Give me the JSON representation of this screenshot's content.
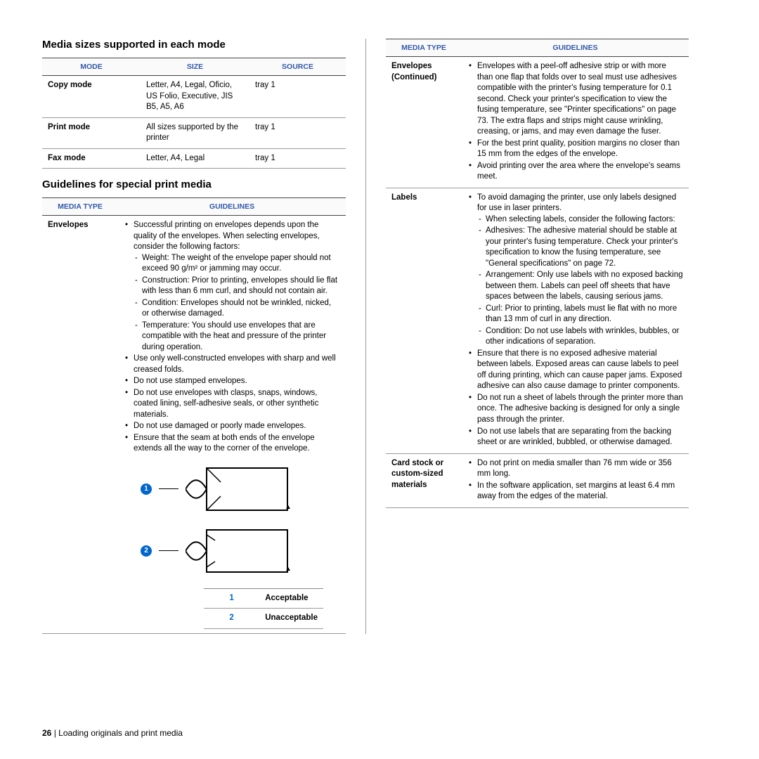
{
  "headings": {
    "media_sizes": "Media sizes supported in each mode",
    "guidelines_special": "Guidelines for special print media"
  },
  "modes_table": {
    "headers": [
      "Mode",
      "Size",
      "Source"
    ],
    "rows": [
      {
        "mode": "Copy mode",
        "size": "Letter, A4, Legal, Oficio, US Folio, Executive, JIS B5, A5, A6",
        "source": "tray 1"
      },
      {
        "mode": "Print mode",
        "size": "All sizes supported by the printer",
        "source": "tray 1"
      },
      {
        "mode": "Fax mode",
        "size": "Letter, A4, Legal",
        "source": "tray 1"
      }
    ]
  },
  "guide_headers": [
    "Media Type",
    "Guidelines"
  ],
  "envelopes": {
    "label": "Envelopes",
    "intro": "Successful printing on envelopes depends upon the quality of the envelopes. When selecting envelopes, consider the following factors:",
    "factors": [
      "Weight: The weight of the envelope paper should not exceed 90 g/m² or jamming may occur.",
      "Construction: Prior to printing, envelopes should lie flat with less than 6 mm curl, and should not contain air.",
      "Condition: Envelopes should not be wrinkled, nicked, or otherwise damaged.",
      "Temperature: You should use envelopes that are compatible with the heat and pressure of the printer during operation."
    ],
    "bullets_after": [
      "Use only well-constructed envelopes with sharp and well creased folds.",
      "Do not use stamped envelopes.",
      "Do not use envelopes with clasps, snaps, windows, coated lining, self-adhesive seals, or other synthetic materials.",
      "Do not use damaged or poorly made envelopes.",
      "Ensure that the seam at both ends of the envelope extends all the way to the corner of the envelope."
    ],
    "legend": [
      {
        "num": "1",
        "label": "Acceptable"
      },
      {
        "num": "2",
        "label": "Unacceptable"
      }
    ]
  },
  "envelopes_cont": {
    "label": "Envelopes (Continued)",
    "bullets": [
      "Envelopes with a peel-off adhesive strip or with more than one flap that folds over to seal must use adhesives compatible with the printer's fusing temperature for 0.1 second. Check your printer's specification to view the fusing temperature, see \"Printer specifications\" on page 73. The extra flaps and strips might cause wrinkling, creasing, or jams, and may even damage the fuser.",
      "For the best print quality, position margins no closer than 15 mm from the edges of the envelope.",
      "Avoid printing over the area where the envelope's seams meet."
    ]
  },
  "labels": {
    "label": "Labels",
    "b1": "To avoid damaging the printer, use only labels designed for use in laser printers.",
    "factors_intro": "When selecting labels, consider the following factors:",
    "factors": [
      "Adhesives: The adhesive material should be stable at your printer's fusing temperature. Check your printer's specification to know the fusing temperature, see \"General specifications\" on page 72.",
      "Arrangement: Only use labels with no exposed backing between them. Labels can peel off sheets that have spaces between the labels, causing serious jams.",
      "Curl: Prior to printing, labels must lie flat with no more than 13 mm of curl in any direction.",
      "Condition: Do not use labels with wrinkles, bubbles, or other indications of separation."
    ],
    "bullets_after": [
      "Ensure that there is no exposed adhesive material between labels. Exposed areas can cause labels to peel off during printing, which can cause paper jams. Exposed adhesive can also cause damage to printer components.",
      "Do not run a sheet of labels through the printer more than once. The adhesive backing is designed for only a single pass through the printer.",
      "Do not use labels that are separating from the backing sheet or are wrinkled, bubbled, or otherwise damaged."
    ]
  },
  "cardstock": {
    "label": "Card stock or custom-sized materials",
    "bullets": [
      "Do not print on media smaller than 76 mm wide or 356 mm long.",
      "In the software application, set margins at least 6.4 mm away from the edges of the material."
    ]
  },
  "footer": {
    "page": "26",
    "sep": " | ",
    "title": "Loading originals and print media"
  }
}
